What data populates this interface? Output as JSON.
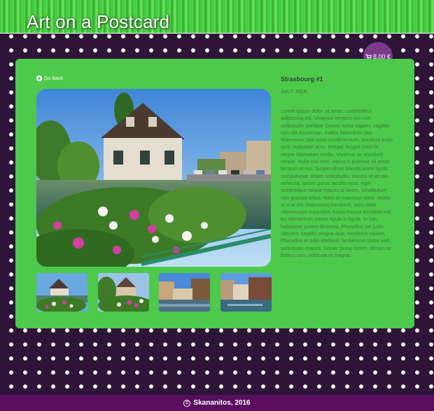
{
  "header": {
    "title": "Art on a Postcard"
  },
  "cart": {
    "label": "8,00 €",
    "icon": "cart-icon"
  },
  "nav": {
    "back_label": "Go Back",
    "back_icon": "arrow-left-circle-icon"
  },
  "product": {
    "title": "Strasbourg #1",
    "date": "Jun 7, 2014",
    "description": "Lorem ipsum dolor sit amet, consectetur adipiscing elit. Vivamus tempus nisi non sollicitudin porttitor. Donec tortor sapien, sagittis non elit accumsan, mattis bibendum nisi. Maecenas sed nunc condimentum, tincidunt justo quis, vulputate arcu. Integer feugiat enim id neque bibendum mollis. Vivamus ac tincidunt neque. Nulla nisi sem, varius a pulvinar sit amet, tempus ut nisi. Suspendisse blandit porta ligula sed pulvinar. Etiam sollicitudin, mauris ut iaculis vehicula, ipsum purus iaculis risus, eget scelerisque neque mauris id lorem. Vestibulum non gravida tellus. Nam et maximus dolor. Morbi at erat elit. Maecenas hendrerit, arcu vitae ullamcorper imperdiet, turpis massa tincidunt est, eu elementum metus ligula in ligula. In hac habitasse platea dictumst. Phasellus vel justo ultricies, sagittis magna quis, hendrerit sapien. Phasellus in odio eleifend, fermentum tortor sed, sollicitudin mauris. Donec purus lorem, dictum ac finibus non, vehicula et magna."
  },
  "footer": {
    "text": "Skananitos, 2016"
  },
  "colors": {
    "panel": "#4dc94c",
    "footer": "#5a0e5e",
    "cart_badge": "#7a3a8c",
    "background": "#2e1538"
  }
}
